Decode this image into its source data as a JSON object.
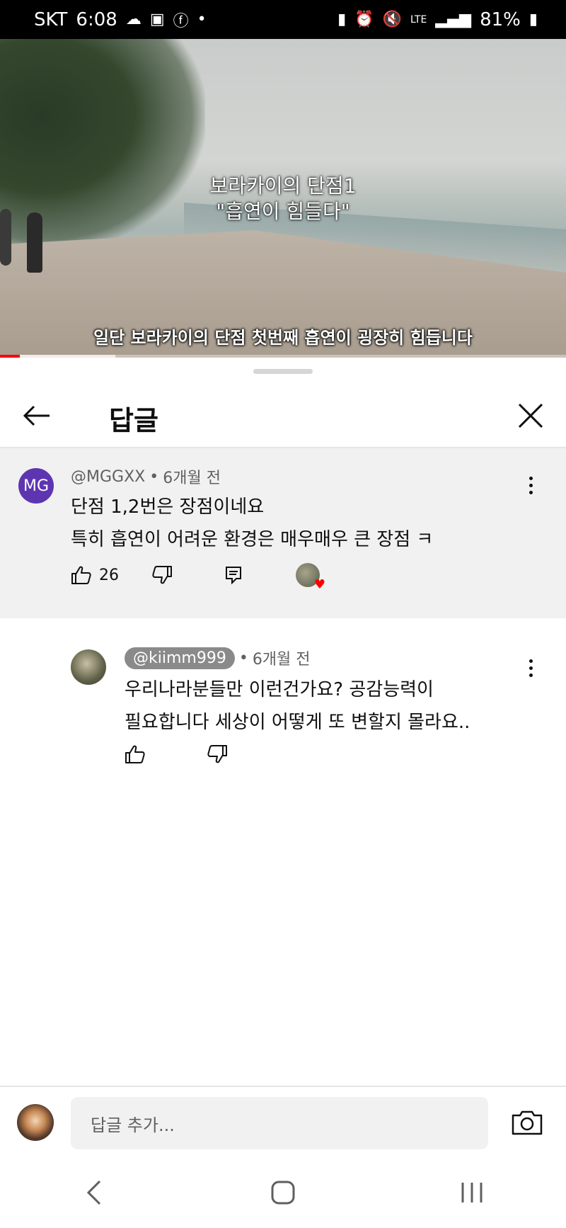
{
  "status_bar": {
    "carrier": "SKT",
    "time": "6:08",
    "network": "LTE",
    "battery": "81%"
  },
  "video": {
    "title_line1": "보라카이의 단점1",
    "title_line2": "\"흡연이 힘들다\"",
    "subtitle": "일단 보라카이의 단점 첫번째 흡연이 굉장히 힘듭니다",
    "progress_fraction": 0.035
  },
  "panel": {
    "title": "답글"
  },
  "parent_comment": {
    "avatar_initials": "MG",
    "author": "@MGGXX",
    "separator": "•",
    "time": "6개월 전",
    "line1": "단점 1,2번은 장점이네요",
    "line2": "특히 흡연이 어려운 환경은 매우매우 큰 장점 ㅋ",
    "likes": "26"
  },
  "reply_comment": {
    "author": "@kiimm999",
    "separator": "•",
    "time": "6개월 전",
    "line1": "우리나라분들만 이런건가요? 공감능력이",
    "line2": "필요합니다 세상이 어떻게 또 변할지 몰라요.."
  },
  "reply_box": {
    "placeholder": "답글 추가..."
  },
  "colors": {
    "accent_red": "#ff0000",
    "avatar_purple": "#5e35b1",
    "parent_bg": "#f1f1f1"
  }
}
